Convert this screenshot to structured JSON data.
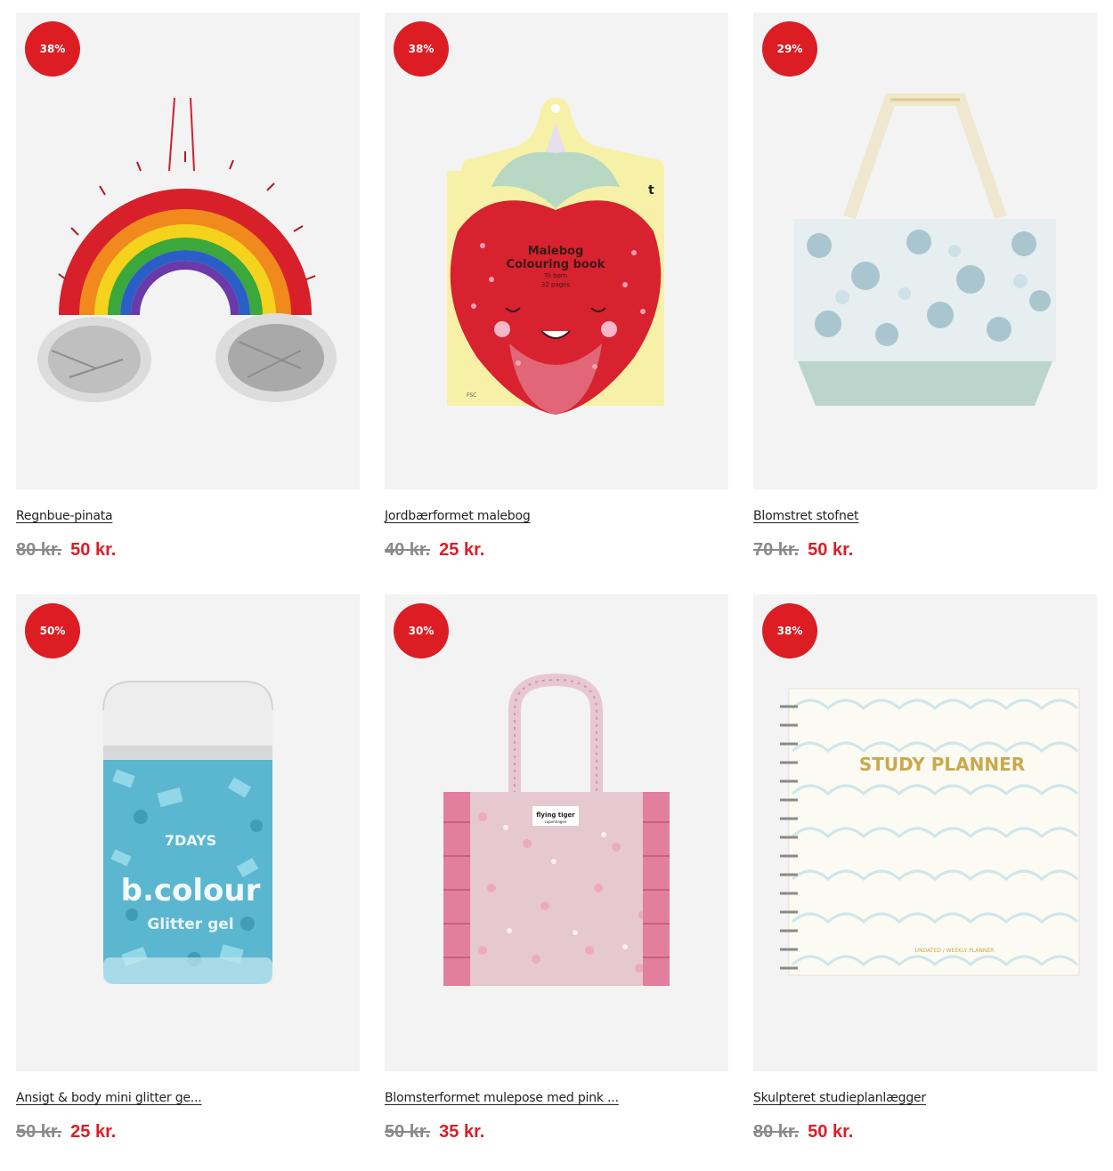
{
  "products": [
    {
      "name": "Regnbue-pinata",
      "discount": "38%",
      "old_price": "80 kr.",
      "new_price": "50 kr."
    },
    {
      "name": "Jordbærformet malebog",
      "discount": "38%",
      "old_price": "40 kr.",
      "new_price": "25 kr.",
      "image_text": {
        "title1": "Malebog",
        "title2": "Colouring book",
        "sub1": "Til børn",
        "sub2": "32 pages",
        "fsc": "FSC",
        "logo": "t"
      }
    },
    {
      "name": "Blomstret stofnet",
      "discount": "29%",
      "old_price": "70 kr.",
      "new_price": "50 kr."
    },
    {
      "name": "Ansigt & body mini glitter ge...",
      "discount": "50%",
      "old_price": "50 kr.",
      "new_price": "25 kr.",
      "image_text": {
        "brand": "7DAYS",
        "line1": "b.colour",
        "line2": "Glitter gel"
      }
    },
    {
      "name": "Blomsterformet mulepose med pink ...",
      "discount": "30%",
      "old_price": "50 kr.",
      "new_price": "35 kr.",
      "image_text": {
        "label1": "flying tiger",
        "label2": "copenhagen"
      }
    },
    {
      "name": "Skulpteret studieplanlægger",
      "discount": "38%",
      "old_price": "80 kr.",
      "new_price": "50 kr.",
      "image_text": {
        "title": "STUDY PLANNER",
        "sub": "UNDATED / WEEKLY PLANNER"
      }
    }
  ],
  "colors": {
    "sale_red": "#dc1d24",
    "card_bg": "#f3f3f3",
    "old_price_gray": "#8a8a8a"
  }
}
